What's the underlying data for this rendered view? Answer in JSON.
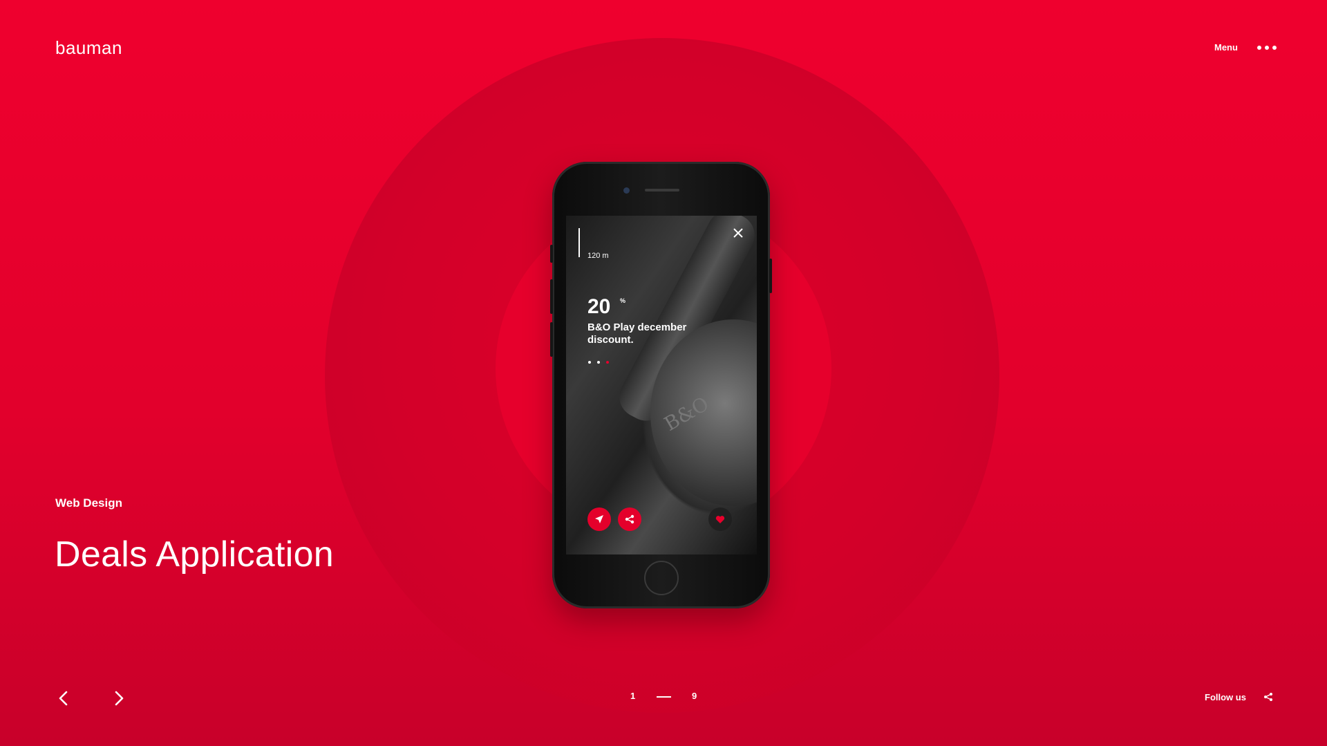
{
  "brand": {
    "logo": "bauman"
  },
  "header": {
    "menu_label": "Menu",
    "more_icon": "more-dots-icon"
  },
  "project": {
    "category": "Web Design",
    "title": "Deals Application"
  },
  "pager": {
    "current": "1",
    "total": "9"
  },
  "footer": {
    "follow_label": "Follow us",
    "share_icon": "share-icon"
  },
  "phone_screen": {
    "distance": "120 m",
    "discount_value": "20",
    "discount_unit": "%",
    "deal_text": "B&O Play december discount.",
    "slides": 3,
    "active_slide": 3,
    "brand_mark": "B&O"
  },
  "colors": {
    "accent": "#e8002c",
    "background": "#ee002d",
    "text": "#ffffff"
  }
}
